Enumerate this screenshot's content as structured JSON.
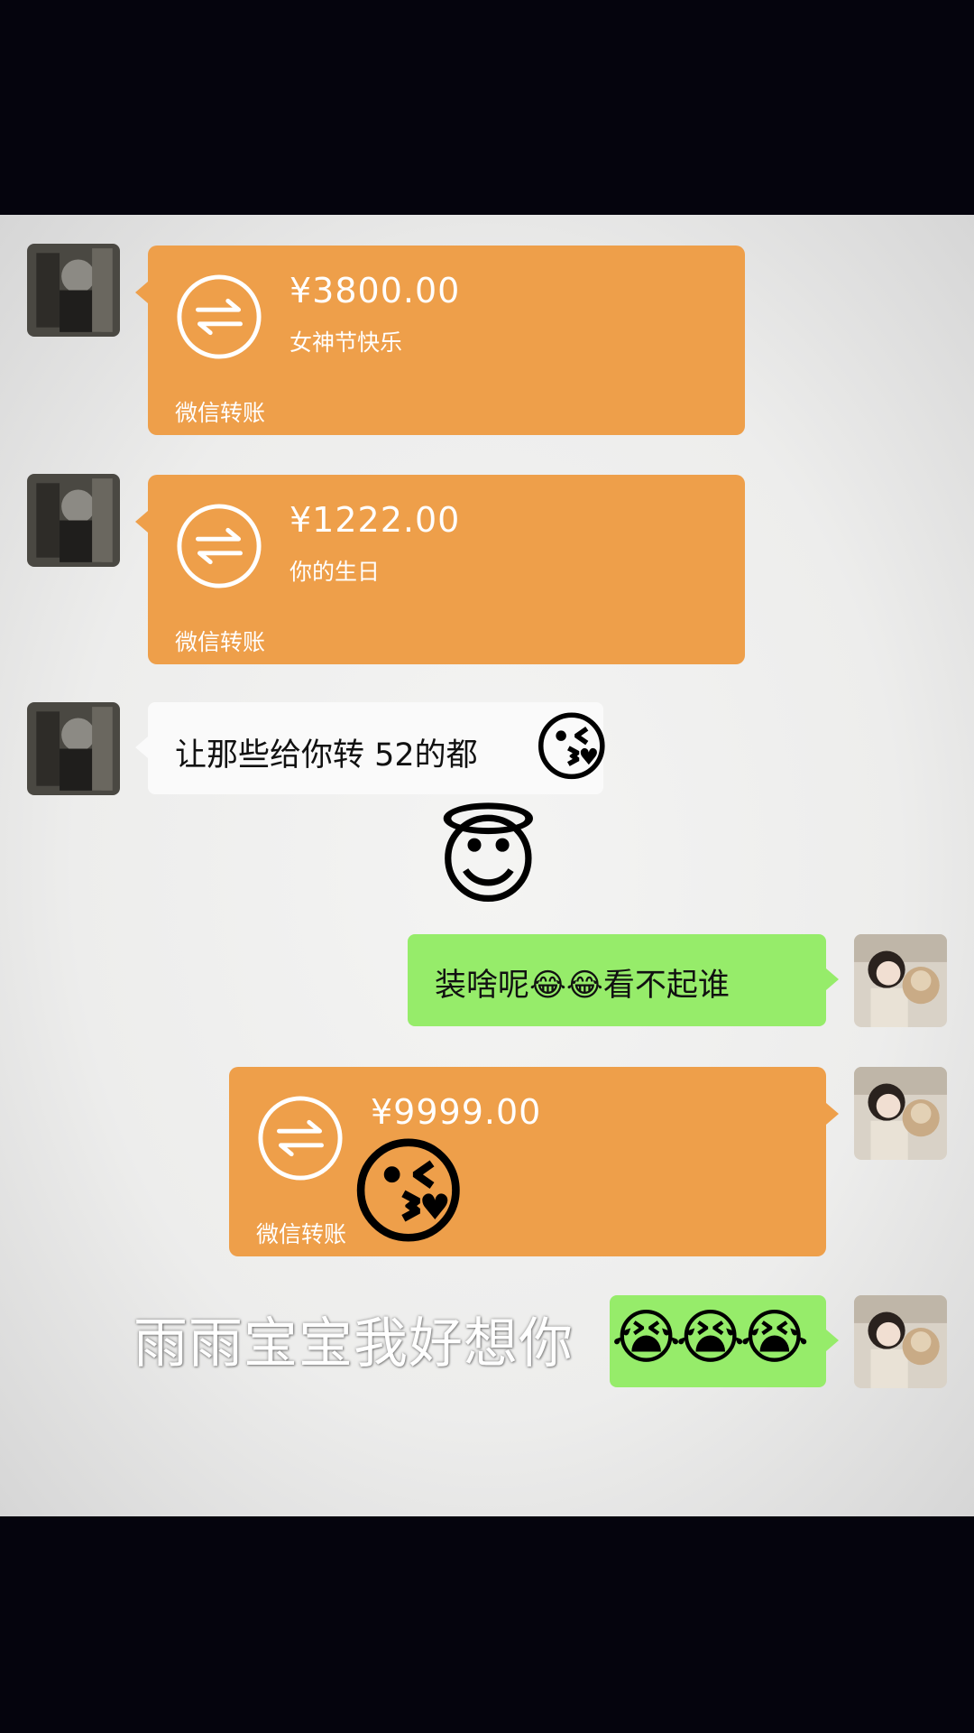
{
  "messages": [
    {
      "type": "transfer",
      "side": "left",
      "amount": "¥3800.00",
      "note": "女神节快乐",
      "footer": "微信转账"
    },
    {
      "type": "transfer",
      "side": "left",
      "amount": "¥1222.00",
      "note": "你的生日",
      "footer": "微信转账"
    },
    {
      "type": "text",
      "side": "left",
      "text": "让那些给你转 52的都",
      "emoji": "😘"
    },
    {
      "type": "emoji",
      "side": "center",
      "emoji": "😇"
    },
    {
      "type": "text",
      "side": "right",
      "text_start": "装啥呢",
      "emoji": "😂😂",
      "text_end": "看不起谁"
    },
    {
      "type": "transfer",
      "side": "right",
      "amount": "¥9999.00",
      "footer": "微信转账",
      "overlay_emoji": "😘"
    },
    {
      "type": "text",
      "side": "right",
      "emoji": "😭😭😭"
    }
  ],
  "caption": "雨雨宝宝我好想你",
  "colors": {
    "transfer": "#ee9f4a",
    "green_bubble": "#96ec6a",
    "white_bubble": "#fafafa",
    "background": "#05040d"
  },
  "icons": {
    "transfer_icon": "transfer-arrows-icon"
  }
}
